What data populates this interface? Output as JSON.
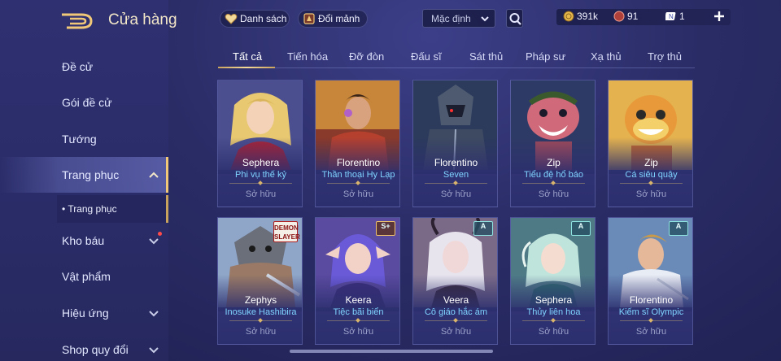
{
  "sidebar": {
    "title": "Cửa hàng",
    "items": [
      {
        "label": "Đề cử"
      },
      {
        "label": "Gói đề cử"
      },
      {
        "label": "Tướng"
      },
      {
        "label": "Trang phục"
      },
      {
        "label": "Kho báu"
      },
      {
        "label": "Vật phẩm"
      },
      {
        "label": "Hiệu ứng"
      },
      {
        "label": "Shop quy đổi"
      }
    ],
    "subitem": "• Trang phục"
  },
  "topbar": {
    "wishlist_label": "Danh sách",
    "exchange_label": "Đổi mảnh",
    "sort_value": "Mặc định",
    "currency": {
      "gold": "391k",
      "ruby": "91",
      "voucher": "1"
    }
  },
  "tabs": [
    "Tất cả",
    "Tiến hóa",
    "Đỡ đòn",
    "Đấu sĩ",
    "Sát thủ",
    "Pháp sư",
    "Xạ thủ",
    "Trợ thủ"
  ],
  "cards": [
    {
      "hero": "Sephera",
      "skin": "Phi vụ thế kỷ",
      "status": "Sở hữu"
    },
    {
      "hero": "Florentino",
      "skin": "Thần thoại Hy Lạp",
      "status": "Sở hữu"
    },
    {
      "hero": "Florentino",
      "skin": "Seven",
      "status": "Sở hữu"
    },
    {
      "hero": "Zip",
      "skin": "Tiểu đệ hổ báo",
      "status": "Sở hữu"
    },
    {
      "hero": "Zip",
      "skin": "Cá siêu quậy",
      "status": "Sở hữu"
    },
    {
      "hero": "Zephys",
      "skin": "Inosuke Hashibira",
      "status": "Sở hữu",
      "badge": "DEMON SLAYER"
    },
    {
      "hero": "Keera",
      "skin": "Tiệc bãi biển",
      "status": "Sở hữu",
      "badge": "S+"
    },
    {
      "hero": "Veera",
      "skin": "Cô giáo hắc ám",
      "status": "Sở hữu",
      "badge": "A"
    },
    {
      "hero": "Sephera",
      "skin": "Thủy liên hoa",
      "status": "Sở hữu",
      "badge": "A"
    },
    {
      "hero": "Florentino",
      "skin": "Kiếm sĩ Olympic",
      "status": "Sở hữu",
      "badge": "A"
    }
  ],
  "colors": {
    "accent_gold": "#f0c878",
    "skin_name": "#7fd3ff",
    "background": "#2a2c66"
  }
}
